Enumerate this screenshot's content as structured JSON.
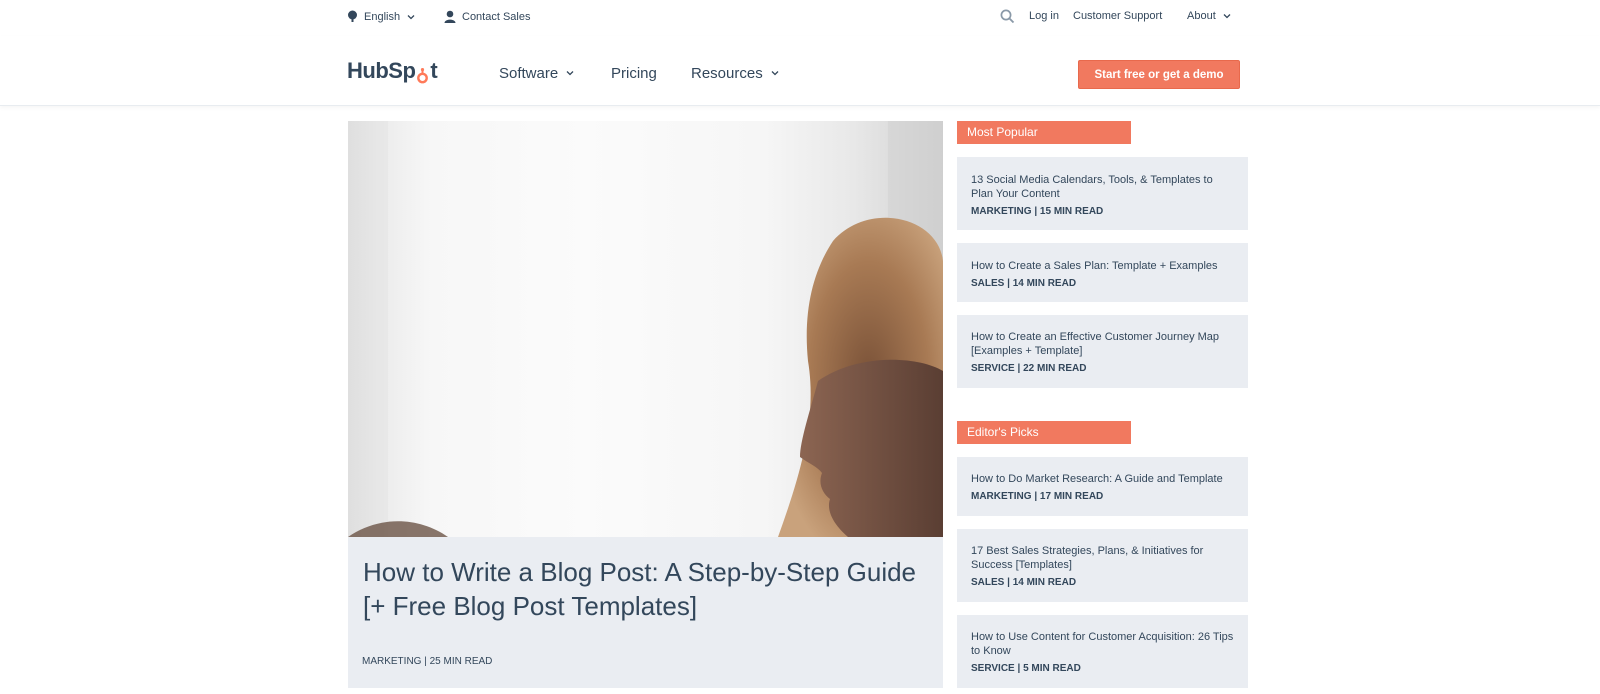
{
  "utility": {
    "language_label": "English",
    "contact_label": "Contact Sales",
    "login_label": "Log in",
    "support_label": "Customer Support",
    "about_label": "About"
  },
  "nav": {
    "logo_text_a": "HubSp",
    "logo_text_b": "t",
    "software_label": "Software",
    "pricing_label": "Pricing",
    "resources_label": "Resources",
    "cta_label": "Start free or get a demo"
  },
  "hero": {
    "title": "How to Write a Blog Post: A Step-by-Step Guide [+ Free Blog Post Templates]",
    "category": "MARKETING",
    "read_time": "25 MIN READ"
  },
  "most_popular": {
    "label": "Most Popular",
    "items": [
      {
        "title": "13 Social Media Calendars, Tools, & Templates to Plan Your Content",
        "category": "MARKETING",
        "read_time": "15 MIN READ"
      },
      {
        "title": "How to Create a Sales Plan: Template + Examples",
        "category": "SALES",
        "read_time": "14 MIN READ"
      },
      {
        "title": "How to Create an Effective Customer Journey Map [Examples + Template]",
        "category": "SERVICE",
        "read_time": "22 MIN READ"
      }
    ]
  },
  "editors_picks": {
    "label": "Editor's Picks",
    "items": [
      {
        "title": "How to Do Market Research: A Guide and Template",
        "category": "MARKETING",
        "read_time": "17 MIN READ"
      },
      {
        "title": "17 Best Sales Strategies, Plans, & Initiatives for Success [Templates]",
        "category": "SALES",
        "read_time": "14 MIN READ"
      },
      {
        "title": "How to Use Content for Customer Acquisition: 26 Tips to Know",
        "category": "SERVICE",
        "read_time": "5 MIN READ"
      }
    ]
  },
  "colors": {
    "accent": "#f1795f",
    "text": "#33475b",
    "card_bg": "#eaedf2"
  },
  "icons": {
    "language": "globe-icon",
    "contact": "person-icon",
    "search": "search-icon",
    "dropdown": "chevron-down-icon"
  }
}
